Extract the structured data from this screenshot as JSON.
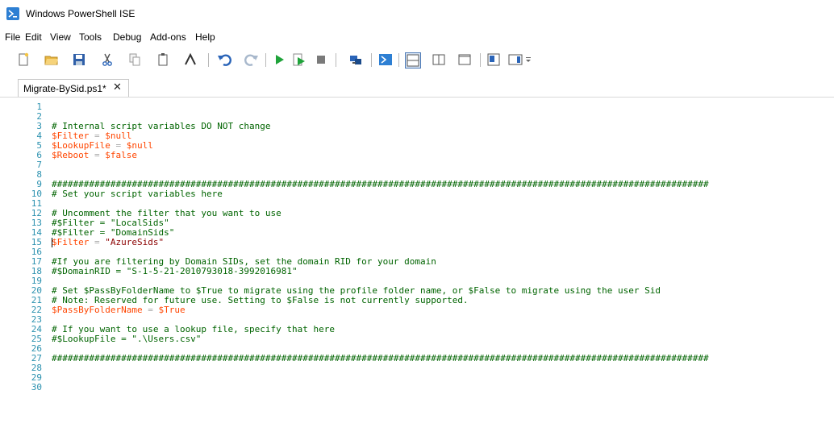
{
  "window": {
    "title": "Windows PowerShell ISE"
  },
  "menu": [
    "File",
    "Edit",
    "View",
    "Tools",
    "Debug",
    "Add-ons",
    "Help"
  ],
  "toolbar_icons": [
    "new-icon",
    "open-icon",
    "save-icon",
    "cut-icon",
    "copy-icon",
    "paste-icon",
    "console-icon",
    "undo-icon",
    "redo-icon",
    "run-icon",
    "run-selection-icon",
    "stop-icon",
    "remote-icon",
    "powershell-icon",
    "layout-top-icon",
    "layout-right-icon",
    "layout-max-icon",
    "script-pane-icon",
    "command-icon"
  ],
  "tab": {
    "label": "Migrate-BySid.ps1*",
    "close": "✕"
  },
  "line_numbers": [
    "1",
    "2",
    "3",
    "4",
    "5",
    "6",
    "7",
    "8",
    "9",
    "10",
    "11",
    "12",
    "13",
    "14",
    "15",
    "16",
    "17",
    "18",
    "19",
    "20",
    "21",
    "22",
    "23",
    "24",
    "25",
    "26",
    "27",
    "28",
    "29",
    "30"
  ],
  "code": {
    "l3": "# Internal script variables DO NOT change",
    "l4_var": "$Filter",
    "l4_val": "$null",
    "l5_var": "$LookupFile",
    "l5_val": "$null",
    "l6_var": "$Reboot",
    "l6_val": "$false",
    "l9": "###########################################################################################################################",
    "l10": "# Set your script variables here",
    "l12": "# Uncomment the filter that you want to use",
    "l13": "#$Filter = \"LocalSids\"",
    "l14": "#$Filter = \"DomainSids\"",
    "l15_var": "$Filter",
    "l15_val": "\"AzureSids\"",
    "l17": "#If you are filtering by Domain SIDs, set the domain RID for your domain",
    "l18": "#$DomainRID = \"S-1-5-21-2010793018-3992016981\"",
    "l20": "# Set $PassByFolderName to $True to migrate using the profile folder name, or $False to migrate using the user Sid",
    "l21": "# Note: Reserved for future use. Setting to $False is not currently supported.",
    "l22_var": "$PassByFolderName",
    "l22_val": "$True",
    "l24": "# If you want to use a lookup file, specify that here",
    "l25": "#$LookupFile = \".\\Users.csv\"",
    "l27": "###########################################################################################################################",
    "eq": "="
  },
  "colors": {
    "comment": "#006400",
    "variable": "#ff4500",
    "string": "#8b0000",
    "operator": "#a9a9a9",
    "line_number": "#2b91af"
  }
}
